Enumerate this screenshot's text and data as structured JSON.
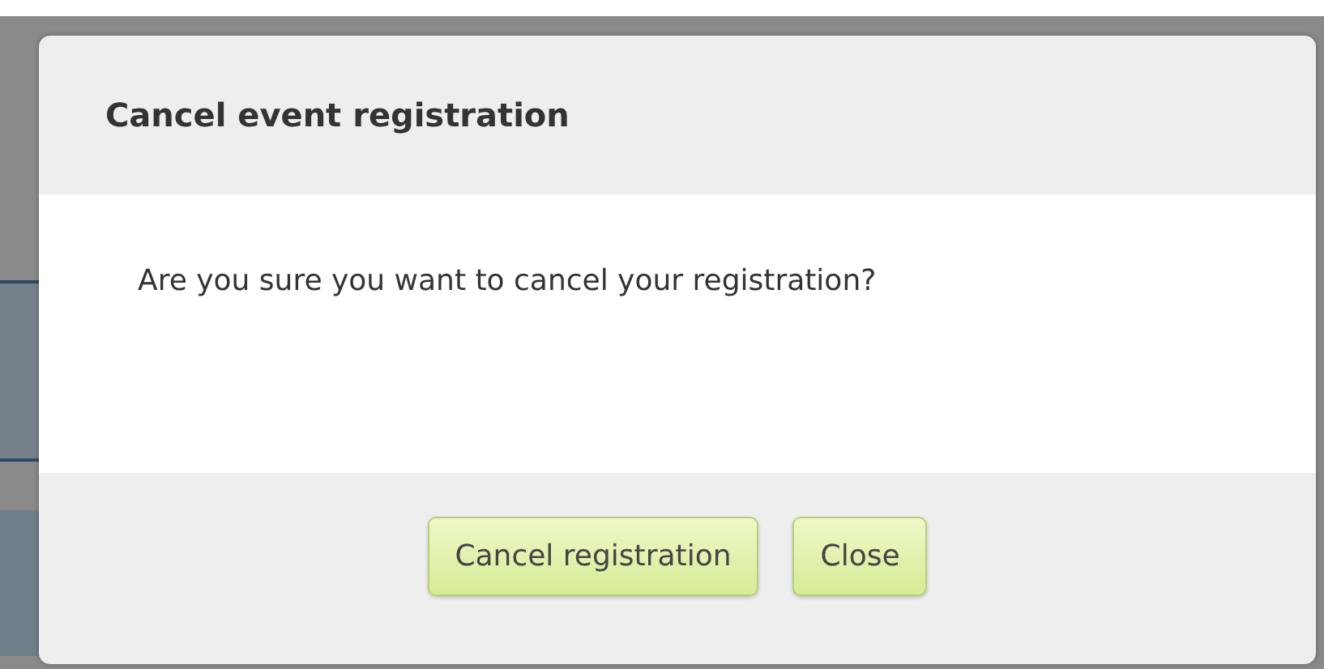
{
  "dialog": {
    "title": "Cancel event registration",
    "message": "Are you sure you want to cancel your registration?",
    "buttons": [
      "Cancel registration",
      "Close"
    ]
  }
}
